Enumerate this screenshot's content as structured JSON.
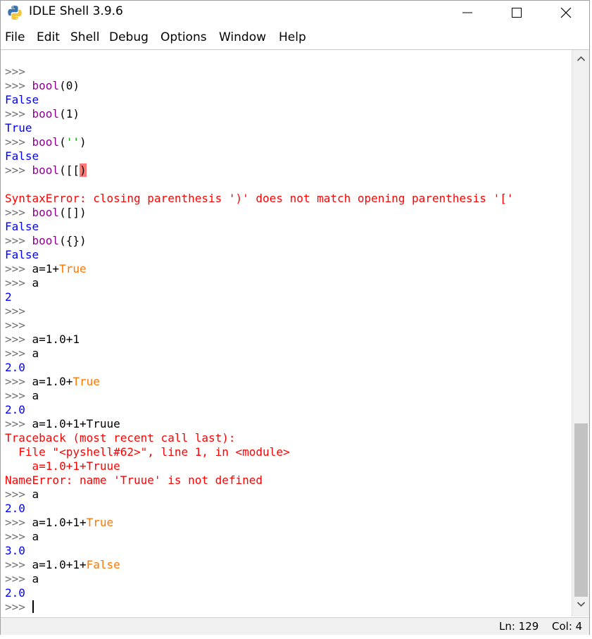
{
  "window": {
    "title": "IDLE Shell 3.9.6",
    "icon": "python-icon"
  },
  "menu": [
    "File",
    "Edit",
    "Shell",
    "Debug",
    "Options",
    "Window",
    "Help"
  ],
  "shell": {
    "lines": [
      [
        {
          "t": ">>>",
          "c": "prompt"
        }
      ],
      [
        {
          "t": ">>> ",
          "c": "prompt"
        },
        {
          "t": "bool",
          "c": "builtin"
        },
        {
          "t": "(0)",
          "c": "code"
        }
      ],
      [
        {
          "t": "False",
          "c": "out"
        }
      ],
      [
        {
          "t": ">>> ",
          "c": "prompt"
        },
        {
          "t": "bool",
          "c": "builtin"
        },
        {
          "t": "(1)",
          "c": "code"
        }
      ],
      [
        {
          "t": "True",
          "c": "out"
        }
      ],
      [
        {
          "t": ">>> ",
          "c": "prompt"
        },
        {
          "t": "bool",
          "c": "builtin"
        },
        {
          "t": "(",
          "c": "code"
        },
        {
          "t": "''",
          "c": "str"
        },
        {
          "t": ")",
          "c": "code"
        }
      ],
      [
        {
          "t": "False",
          "c": "out"
        }
      ],
      [
        {
          "t": ">>> ",
          "c": "prompt"
        },
        {
          "t": "bool",
          "c": "builtin"
        },
        {
          "t": "([[",
          "c": "code"
        },
        {
          "t": ")",
          "c": "hl"
        }
      ],
      [],
      [
        {
          "t": "SyntaxError: closing parenthesis ')' does not match opening parenthesis '['",
          "c": "err"
        }
      ],
      [
        {
          "t": ">>> ",
          "c": "prompt"
        },
        {
          "t": "bool",
          "c": "builtin"
        },
        {
          "t": "([])",
          "c": "code"
        }
      ],
      [
        {
          "t": "False",
          "c": "out"
        }
      ],
      [
        {
          "t": ">>> ",
          "c": "prompt"
        },
        {
          "t": "bool",
          "c": "builtin"
        },
        {
          "t": "({})",
          "c": "code"
        }
      ],
      [
        {
          "t": "False",
          "c": "out"
        }
      ],
      [
        {
          "t": ">>> ",
          "c": "prompt"
        },
        {
          "t": "a=1+",
          "c": "code"
        },
        {
          "t": "True",
          "c": "kw"
        }
      ],
      [
        {
          "t": ">>> ",
          "c": "prompt"
        },
        {
          "t": "a",
          "c": "code"
        }
      ],
      [
        {
          "t": "2",
          "c": "out"
        }
      ],
      [
        {
          "t": ">>>",
          "c": "prompt"
        }
      ],
      [
        {
          "t": ">>>",
          "c": "prompt"
        }
      ],
      [
        {
          "t": ">>> ",
          "c": "prompt"
        },
        {
          "t": "a=1.0+1",
          "c": "code"
        }
      ],
      [
        {
          "t": ">>> ",
          "c": "prompt"
        },
        {
          "t": "a",
          "c": "code"
        }
      ],
      [
        {
          "t": "2.0",
          "c": "out"
        }
      ],
      [
        {
          "t": ">>> ",
          "c": "prompt"
        },
        {
          "t": "a=1.0+",
          "c": "code"
        },
        {
          "t": "True",
          "c": "kw"
        }
      ],
      [
        {
          "t": ">>> ",
          "c": "prompt"
        },
        {
          "t": "a",
          "c": "code"
        }
      ],
      [
        {
          "t": "2.0",
          "c": "out"
        }
      ],
      [
        {
          "t": ">>> ",
          "c": "prompt"
        },
        {
          "t": "a=1.0+1+Truue",
          "c": "code"
        }
      ],
      [
        {
          "t": "Traceback (most recent call last):",
          "c": "err"
        }
      ],
      [
        {
          "t": "  File \"<pyshell#62>\", line 1, in <module>",
          "c": "err"
        }
      ],
      [
        {
          "t": "    a=1.0+1+Truue",
          "c": "err"
        }
      ],
      [
        {
          "t": "NameError: name 'Truue' is not defined",
          "c": "err"
        }
      ],
      [
        {
          "t": ">>> ",
          "c": "prompt"
        },
        {
          "t": "a",
          "c": "code"
        }
      ],
      [
        {
          "t": "2.0",
          "c": "out"
        }
      ],
      [
        {
          "t": ">>> ",
          "c": "prompt"
        },
        {
          "t": "a=1.0+1+",
          "c": "code"
        },
        {
          "t": "True",
          "c": "kw"
        }
      ],
      [
        {
          "t": ">>> ",
          "c": "prompt"
        },
        {
          "t": "a",
          "c": "code"
        }
      ],
      [
        {
          "t": "3.0",
          "c": "out"
        }
      ],
      [
        {
          "t": ">>> ",
          "c": "prompt"
        },
        {
          "t": "a=1.0+1+",
          "c": "code"
        },
        {
          "t": "False",
          "c": "kw"
        }
      ],
      [
        {
          "t": ">>> ",
          "c": "prompt"
        },
        {
          "t": "a",
          "c": "code"
        }
      ],
      [
        {
          "t": "2.0",
          "c": "out"
        }
      ],
      [
        {
          "t": ">>> ",
          "c": "prompt"
        }
      ]
    ]
  },
  "status": {
    "ln": "Ln: 129",
    "col": "Col: 4"
  },
  "colors": {
    "prompt": "#6f6f6f",
    "output": "#0000ff",
    "error": "#ff0000",
    "keyword": "#ff7700",
    "builtin": "#900090",
    "string": "#00aa00",
    "highlight": "#ff7777"
  }
}
